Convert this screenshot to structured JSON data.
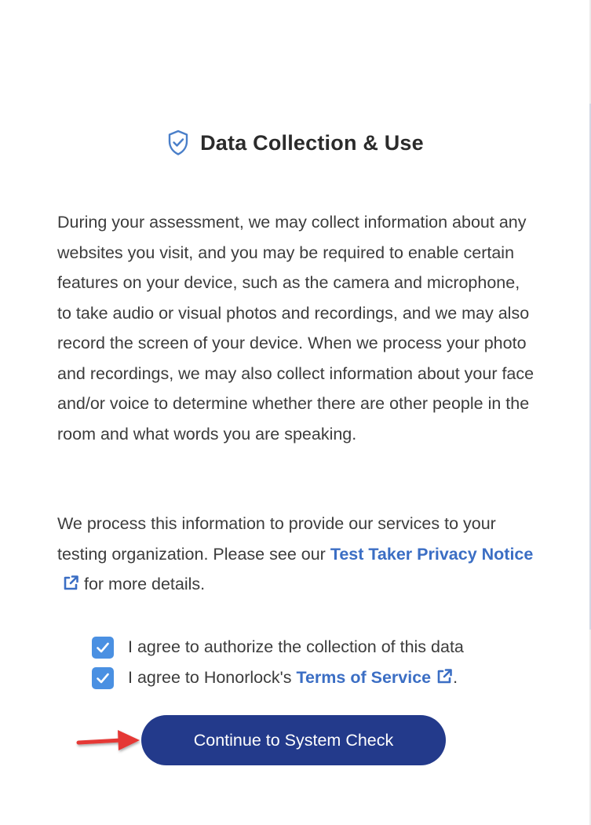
{
  "header": {
    "title": "Data Collection & Use",
    "icon": "shield-check-icon"
  },
  "body": {
    "paragraph1": "During your assessment, we may collect information about any websites you visit, and you may be required to enable certain features on your device, such as the camera and microphone, to take audio or visual photos and recordings, and we may also record the screen of your device. When we process your photo and recordings, we may also collect information about your face and/or voice to determine whether there are other people in the room and what words you are speaking.",
    "paragraph2_before": "We process this information to provide our services to your testing organization. Please see our ",
    "paragraph2_link": "Test Taker Privacy Notice",
    "paragraph2_after": " for more details."
  },
  "agreements": {
    "item1_label": "I agree to authorize the collection of this data",
    "item2_before": "I agree to Honorlock's ",
    "item2_link": "Terms of Service",
    "item2_after": ".",
    "item1_checked": true,
    "item2_checked": true
  },
  "actions": {
    "continue_label": "Continue to System Check"
  },
  "colors": {
    "accent": "#4a90e2",
    "link": "#3b6ec4",
    "button": "#233a8b",
    "arrow": "#e53935"
  }
}
